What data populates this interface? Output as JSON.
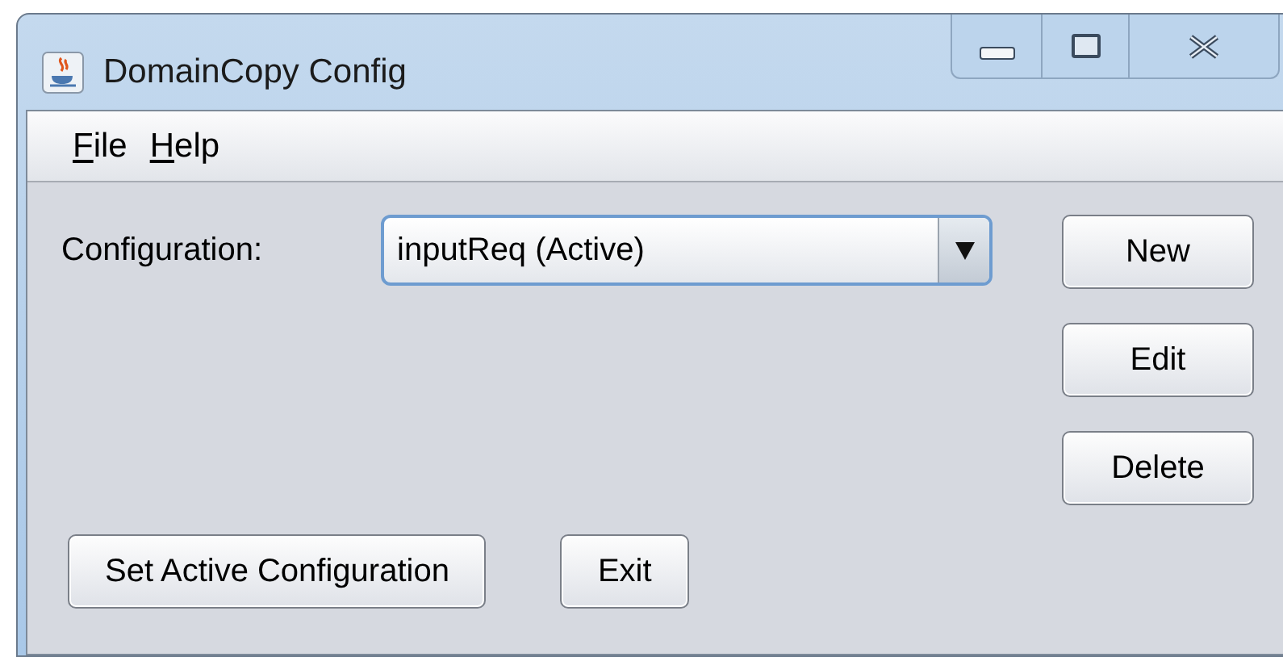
{
  "window": {
    "title": "DomainCopy Config"
  },
  "menu": [
    "File",
    "Help"
  ],
  "configuration": {
    "label": "Configuration:",
    "value": "inputReq (Active)"
  },
  "side_buttons": [
    "New",
    "Edit",
    "Delete"
  ],
  "bottom_buttons": [
    "Set Active Configuration",
    "Exit"
  ]
}
